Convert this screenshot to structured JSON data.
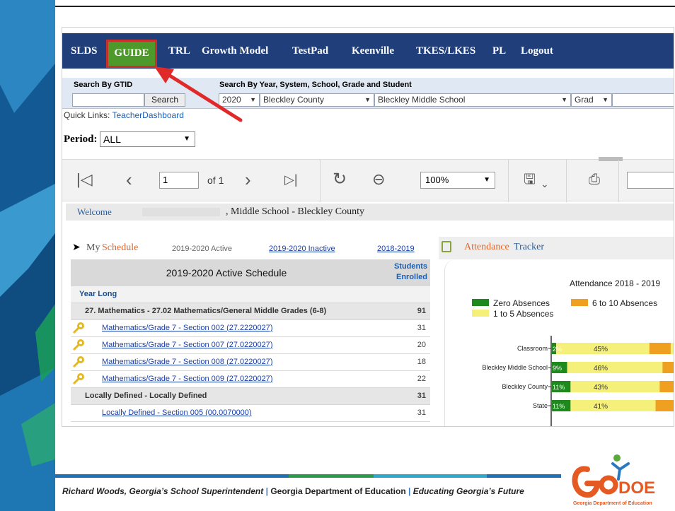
{
  "nav": {
    "items": [
      "SLDS",
      "GUIDE",
      "TRL",
      "Growth Model",
      "TestPad",
      "Keenville",
      "TKES/LKES",
      "PL",
      "Logout"
    ]
  },
  "search": {
    "gtid_label": "Search By GTID",
    "search_button": "Search",
    "by_label": "Search By Year, System, School, Grade and Student",
    "year": "2020",
    "system": "Bleckley County",
    "school": "Bleckley Middle School",
    "grade": "Grad"
  },
  "quick_links": {
    "label": "Quick Links:",
    "link": "TeacherDashboard"
  },
  "period": {
    "label": "Period:",
    "value": "ALL"
  },
  "toolbar": {
    "page": "1",
    "of": "of 1",
    "zoom": "100%"
  },
  "welcome": {
    "label": "Welcome",
    "school_line": ", Middle School - Bleckley County"
  },
  "schedule": {
    "title_prefix": "My",
    "title_suffix": "Schedule",
    "tab_active": "2019-2020 Active",
    "tab_inactive": "2019-2020 Inactive",
    "tab_prior": "2018-2019",
    "table_title": "2019-2020 Active Schedule",
    "students_header_1": "Students",
    "students_header_2": "Enrolled",
    "rows": [
      {
        "type": "yl",
        "label": "Year Long",
        "count": ""
      },
      {
        "type": "group",
        "label": "27. Mathematics - 27.02 Mathematics/General Middle Grades (6-8)",
        "count": "91"
      },
      {
        "type": "link",
        "label": "Mathematics/Grade 7  - Section 002 (27.2220027)",
        "count": "31"
      },
      {
        "type": "link",
        "label": "Mathematics/Grade 7  - Section 007 (27.0220027)",
        "count": "20"
      },
      {
        "type": "link",
        "label": "Mathematics/Grade 7  - Section 008 (27.0220027)",
        "count": "18"
      },
      {
        "type": "link",
        "label": "Mathematics/Grade 7  - Section 009 (27.0220027)",
        "count": "22"
      },
      {
        "type": "group",
        "label": "Locally Defined - Locally Defined",
        "count": "31"
      },
      {
        "type": "link2",
        "label": "Locally Defined - Section 005 (00.0070000)",
        "count": "31"
      }
    ]
  },
  "attendance": {
    "title_a": "Attendance",
    "title_b": "Tracker",
    "chart_title": "Attendance 2018 - 2019",
    "legend": [
      "Zero Absences",
      "6 to 10 Absences",
      "1 to 5 Absences"
    ],
    "colors": {
      "zero": "#1e8a1e",
      "one_to_five": "#f4f07a",
      "six_to_ten": "#f0a020"
    },
    "bars": [
      {
        "label": "Classroom",
        "zero": "2%",
        "mid": "45%"
      },
      {
        "label": "Bleckley Middle School",
        "zero": "9%",
        "mid": "46%"
      },
      {
        "label": "Bleckley County",
        "zero": "11%",
        "mid": "43%"
      },
      {
        "label": "State",
        "zero": "11%",
        "mid": "41%"
      }
    ]
  },
  "footer": {
    "name": "Richard Woods, Georgia’s School Superintendent",
    "sep": "|",
    "dept": "Georgia Department of Education",
    "tagline": "Educating Georgia’s Future",
    "logo_text": "Ga DOE",
    "logo_sub": "Georgia Department of Education"
  }
}
